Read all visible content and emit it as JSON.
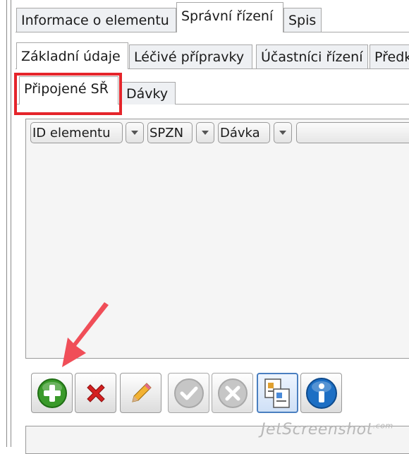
{
  "tabs_row1": [
    "Informace o elementu",
    "Správní řízení",
    "Spis"
  ],
  "tabs_row2": [
    "Základní údaje",
    "Léčivé přípravky",
    "Účastníci řízení",
    "Předkl"
  ],
  "tabs_row3": [
    "Připojené SŘ",
    "Dávky"
  ],
  "columns": [
    "ID elementu",
    "SPZN",
    "Dávka"
  ],
  "toolbar_icons": [
    "add-icon",
    "delete-icon",
    "edit-icon",
    "confirm-icon",
    "cancel-icon",
    "copy-icon",
    "info-icon"
  ],
  "watermark": "JetScreenshot",
  "watermark_sup": ".com",
  "colors": {
    "highlight": "#e5252b",
    "arrow": "#f04e58",
    "add": "#3a9a2a",
    "delete": "#d42020",
    "info": "#1d6fc4"
  }
}
